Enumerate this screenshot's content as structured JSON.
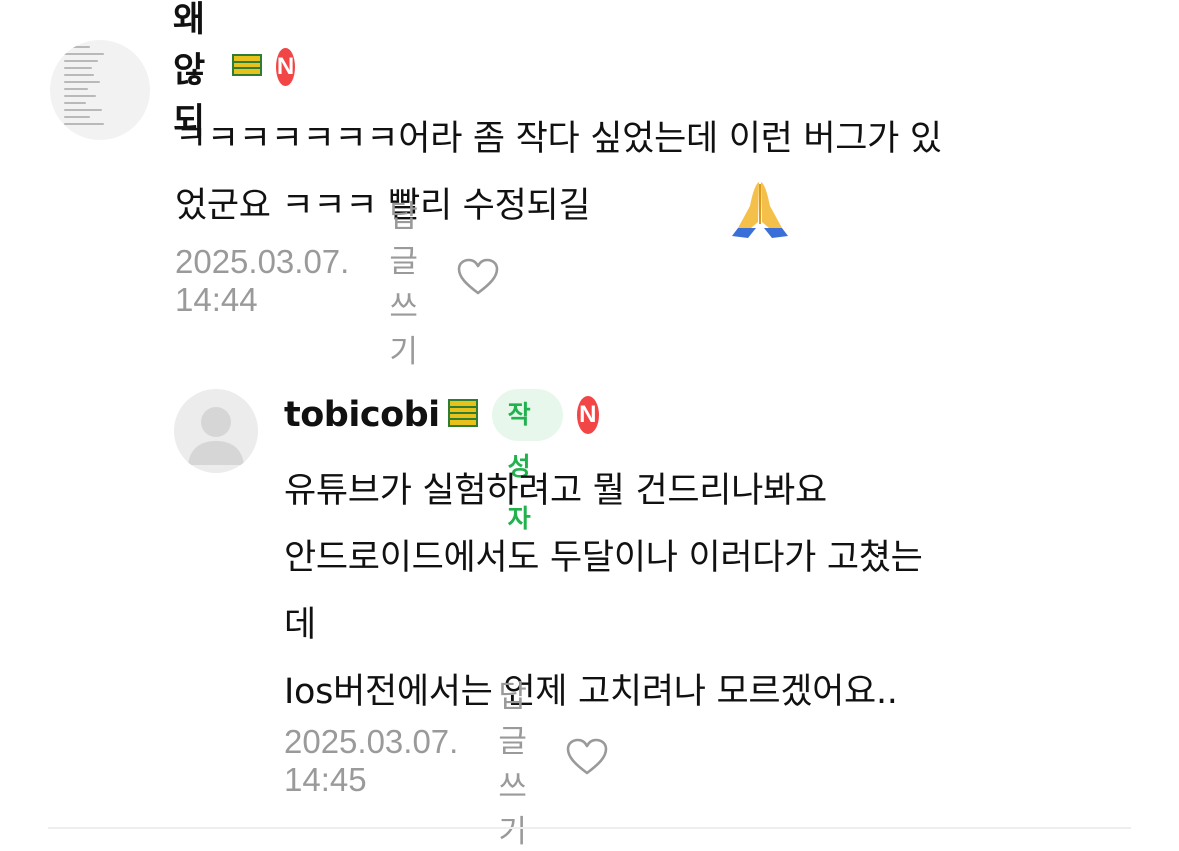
{
  "comments": [
    {
      "author": "왜 않되",
      "new_badge": "N",
      "level_icon": "level-stripes-icon",
      "avatar_icon": "list-thumbnail-avatar",
      "text": "ㅋㅋㅋㅋㅋㅋㅋ어라 좀 작다 싶었는데 이런 버그가 있\n었군요 ㅋㅋㅋ 빨리 수정되길",
      "emoji": "folded-hands-icon",
      "timestamp": "2025.03.07. 14:44",
      "reply_label": "답글쓰기",
      "like_icon": "heart-outline-icon"
    },
    {
      "author": "tobicobi",
      "author_badge": "작성자",
      "new_badge": "N",
      "level_icon": "level-stripes-icon",
      "avatar_icon": "default-user-avatar",
      "text": "유튜브가 실험하려고 뭘 건드리나봐요\n안드로이드에서도 두달이나 이러다가 고쳤는\n데\nIos버전에서는 언제 고치려나 모르겠어요..",
      "timestamp": "2025.03.07. 14:45",
      "reply_label": "답글쓰기",
      "like_icon": "heart-outline-icon"
    }
  ],
  "colors": {
    "author_badge_bg": "#e8f7ec",
    "author_badge_text": "#21b24e",
    "new_badge_bg": "#f24545",
    "meta_text": "#9a9a9a",
    "level_yellow": "#e8c21a",
    "level_green": "#2e7d32"
  }
}
